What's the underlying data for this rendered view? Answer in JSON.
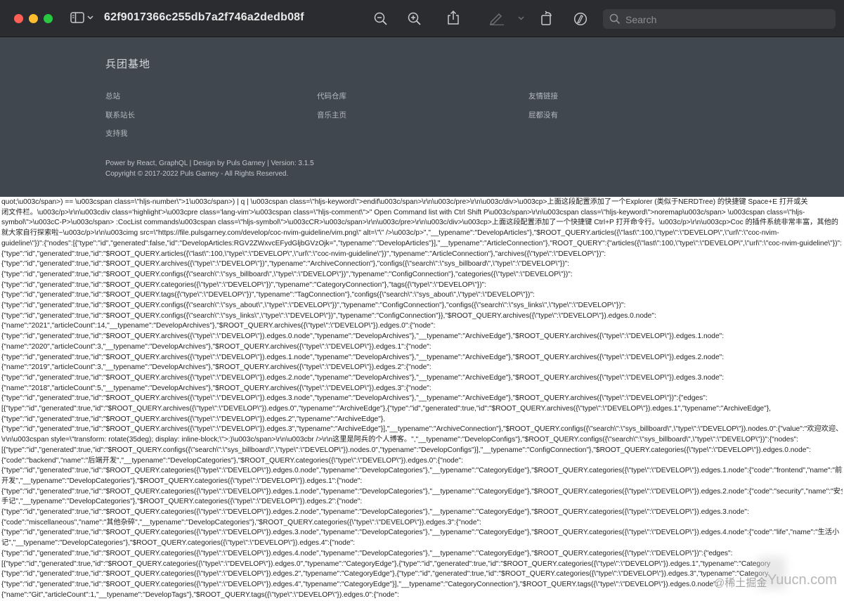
{
  "window": {
    "title": "62f9017366c255db7a2f746a2dedb08f",
    "search_placeholder": "Search",
    "toolbar_icons": [
      "sidebar-icon",
      "chevron-down-icon",
      "zoom-out-icon",
      "zoom-in-icon",
      "share-icon",
      "markup-pen-icon",
      "chevron-down-icon",
      "rotate-icon",
      "annotate-icon",
      "search-icon"
    ]
  },
  "footer": {
    "site_title": "兵团基地",
    "links": [
      "总站",
      "代码仓库",
      "友情链接",
      "联系站长",
      "音乐主页",
      "屁都没有",
      "支持我"
    ],
    "powered": "Power by React, GraphQL | Design by Puls Garney | Version: 3.1.5",
    "copyright": "Copyright © 2017-2022 Puls Garney - All Rights Reserved."
  },
  "dump_lines": [
    "quot;\\u003c/span>) == \\u003cspan class=\\\"hljs-number\\\">1\\u003c/span>) | q | \\u003cspan class=\\\"hljs-keyword\\\">endif\\u003c/span>\\r\\n\\u003c/pre>\\r\\n\\u003c/div>\\u003cp>上面这段配置添加了一个Explorer (类似于NERDTree) 的快捷键 Space+E 打开或关",
    "闭文件栏。\\u003c/p>\\r\\n\\u003cdiv class='highlight'>\\u003cpre class='lang-vim'>\\u003cspan class=\\\"hljs-comment\\\">\" Open Command list with Ctrl Shift P\\u003c/span>\\r\\n\\u003cspan class=\\\"hljs-keyword\\\">noremap\\u003c/span> \\u003cspan class=\\\"hljs-",
    "symbol\\\">\\u003cC-P>\\u003c/span> :CocList commands\\u003cspan class=\\\"hljs-symbol\\\">\\u003cCR>\\u003c/span>\\r\\n\\u003c/pre>\\r\\n\\u003c/div>\\u003cp>上面这段配置添加了一个快捷键 Ctrl+P 打开命令行。\\u003c/p>\\r\\n\\u003cp>Coc 的插件系统非常丰富，其他的",
    "就大家自行探索啦~\\u003c/p>\\r\\n\\u003cimg src=\\\"https://file.pulsgarney.com/develop/coc-nvim-guideline/vim.png\\\" alt=\\\"\\\" />\\u003c/p>\",\"__typename\":\"DevelopArticles\"},\"$ROOT_QUERY.articles({\\\"last\\\":100,\\\"type\\\":\\\"DEVELOP\\\",\\\"url\\\":\\\"coc-nvim-",
    "guideline\\\"})\":{\"nodes\":[{\"type\":\"id\",\"generated\":false,\"id\":\"DevelopArticles:RGV2ZWxvcEFydGljbGVzOjk=\",\"typename\":\"DevelopArticles\"}],\"__typename\":\"ArticleConnection\"},\"ROOT_QUERY\":{\"articles({\\\"last\\\":100,\\\"type\\\":\\\"DEVELOP\\\",\\\"url\\\":\\\"coc-nvim-guideline\\\"})\":",
    "{\"type\":\"id\",\"generated\":true,\"id\":\"$ROOT_QUERY.articles({\\\"last\\\":100,\\\"type\\\":\\\"DEVELOP\\\",\\\"url\\\":\\\"coc-nvim-guideline\\\"})\",\"typename\":\"ArticleConnection\"},\"archives({\\\"type\\\":\\\"DEVELOP\\\"})\":",
    "{\"type\":\"id\",\"generated\":true,\"id\":\"$ROOT_QUERY.archives({\\\"type\\\":\\\"DEVELOP\\\"})\",\"typename\":\"ArchiveConnection\"},\"configs({\\\"search\\\":\\\"sys_billboard\\\",\\\"type\\\":\\\"DEVELOP\\\"})\":",
    "{\"type\":\"id\",\"generated\":true,\"id\":\"$ROOT_QUERY.configs({\\\"search\\\":\\\"sys_billboard\\\",\\\"type\\\":\\\"DEVELOP\\\"})\",\"typename\":\"ConfigConnection\"},\"categories({\\\"type\\\":\\\"DEVELOP\\\"})\":",
    "{\"type\":\"id\",\"generated\":true,\"id\":\"$ROOT_QUERY.categories({\\\"type\\\":\\\"DEVELOP\\\"})\",\"typename\":\"CategoryConnection\"},\"tags({\\\"type\\\":\\\"DEVELOP\\\"})\":",
    "{\"type\":\"id\",\"generated\":true,\"id\":\"$ROOT_QUERY.tags({\\\"type\\\":\\\"DEVELOP\\\"})\",\"typename\":\"TagConnection\"},\"configs({\\\"search\\\":\\\"sys_about\\\",\\\"type\\\":\\\"DEVELOP\\\"})\":",
    "{\"type\":\"id\",\"generated\":true,\"id\":\"$ROOT_QUERY.configs({\\\"search\\\":\\\"sys_about\\\",\\\"type\\\":\\\"DEVELOP\\\"})\",\"typename\":\"ConfigConnection\"},\"configs({\\\"search\\\":\\\"sys_links\\\",\\\"type\\\":\\\"DEVELOP\\\"})\":",
    "{\"type\":\"id\",\"generated\":true,\"id\":\"$ROOT_QUERY.configs({\\\"search\\\":\\\"sys_links\\\",\\\"type\\\":\\\"DEVELOP\\\"})\",\"typename\":\"ConfigConnection\"}},\"$ROOT_QUERY.archives({\\\"type\\\":\\\"DEVELOP\\\"}).edges.0.node\":",
    "{\"name\":\"2021\",\"articleCount\":14,\"__typename\":\"DevelopArchives\"},\"$ROOT_QUERY.archives({\\\"type\\\":\\\"DEVELOP\\\"}).edges.0\":{\"node\":",
    "{\"type\":\"id\",\"generated\":true,\"id\":\"$ROOT_QUERY.archives({\\\"type\\\":\\\"DEVELOP\\\"}).edges.0.node\",\"typename\":\"DevelopArchives\"},\"__typename\":\"ArchiveEdge\"},\"$ROOT_QUERY.archives({\\\"type\\\":\\\"DEVELOP\\\"}).edges.1.node\":",
    "{\"name\":\"2020\",\"articleCount\":3,\"__typename\":\"DevelopArchives\"},\"$ROOT_QUERY.archives({\\\"type\\\":\\\"DEVELOP\\\"}).edges.1\":{\"node\":",
    "{\"type\":\"id\",\"generated\":true,\"id\":\"$ROOT_QUERY.archives({\\\"type\\\":\\\"DEVELOP\\\"}).edges.1.node\",\"typename\":\"DevelopArchives\"},\"__typename\":\"ArchiveEdge\"},\"$ROOT_QUERY.archives({\\\"type\\\":\\\"DEVELOP\\\"}).edges.2.node\":",
    "{\"name\":\"2019\",\"articleCount\":3,\"__typename\":\"DevelopArchives\"},\"$ROOT_QUERY.archives({\\\"type\\\":\\\"DEVELOP\\\"}).edges.2\":{\"node\":",
    "{\"type\":\"id\",\"generated\":true,\"id\":\"$ROOT_QUERY.archives({\\\"type\\\":\\\"DEVELOP\\\"}).edges.2.node\",\"typename\":\"DevelopArchives\"},\"__typename\":\"ArchiveEdge\"},\"$ROOT_QUERY.archives({\\\"type\\\":\\\"DEVELOP\\\"}).edges.3.node\":",
    "{\"name\":\"2018\",\"articleCount\":5,\"__typename\":\"DevelopArchives\"},\"$ROOT_QUERY.archives({\\\"type\\\":\\\"DEVELOP\\\"}).edges.3\":{\"node\":",
    "{\"type\":\"id\",\"generated\":true,\"id\":\"$ROOT_QUERY.archives({\\\"type\\\":\\\"DEVELOP\\\"}).edges.3.node\",\"typename\":\"DevelopArchives\"},\"__typename\":\"ArchiveEdge\"},\"$ROOT_QUERY.archives({\\\"type\\\":\\\"DEVELOP\\\"})\":{\"edges\":",
    "[{\"type\":\"id\",\"generated\":true,\"id\":\"$ROOT_QUERY.archives({\\\"type\\\":\\\"DEVELOP\\\"}).edges.0\",\"typename\":\"ArchiveEdge\"},{\"type\":\"id\",\"generated\":true,\"id\":\"$ROOT_QUERY.archives({\\\"type\\\":\\\"DEVELOP\\\"}).edges.1\",\"typename\":\"ArchiveEdge\"},",
    "{\"type\":\"id\",\"generated\":true,\"id\":\"$ROOT_QUERY.archives({\\\"type\\\":\\\"DEVELOP\\\"}).edges.2\",\"typename\":\"ArchiveEdge\"},",
    "{\"type\":\"id\",\"generated\":true,\"id\":\"$ROOT_QUERY.archives({\\\"type\\\":\\\"DEVELOP\\\"}).edges.3\",\"typename\":\"ArchiveEdge\"}],\"__typename\":\"ArchiveConnection\"},\"$ROOT_QUERY.configs({\\\"search\\\":\\\"sys_billboard\\\",\\\"type\\\":\\\"DEVELOP\\\"}).nodes.0\":{\"value\":\"欢迎欢迎、",
    "\\r\\n\\u003cspan style=\\\"transform: rotate(35deg); display: inline-block;\\\">:)\\u003c/span>\\r\\n\\u003cbr />\\r\\n这里是阿兵的个人博客。\",\"__typename\":\"DevelopConfigs\"},\"$ROOT_QUERY.configs({\\\"search\\\":\\\"sys_billboard\\\",\\\"type\\\":\\\"DEVELOP\\\"})\":{\"nodes\":",
    "[{\"type\":\"id\",\"generated\":true,\"id\":\"$ROOT_QUERY.configs({\\\"search\\\":\\\"sys_billboard\\\",\\\"type\\\":\\\"DEVELOP\\\"}).nodes.0\",\"typename\":\"DevelopConfigs\"}],\"__typename\":\"ConfigConnection\"},\"$ROOT_QUERY.categories({\\\"type\\\":\\\"DEVELOP\\\"}).edges.0.node\":",
    "{\"code\":\"backend\",\"name\":\"后端开发\",\"__typename\":\"DevelopCategories\"},\"$ROOT_QUERY.categories({\\\"type\\\":\\\"DEVELOP\\\"}).edges.0\":{\"node\":",
    "{\"type\":\"id\",\"generated\":true,\"id\":\"$ROOT_QUERY.categories({\\\"type\\\":\\\"DEVELOP\\\"}).edges.0.node\",\"typename\":\"DevelopCategories\"},\"__typename\":\"CategoryEdge\"},\"$ROOT_QUERY.categories({\\\"type\\\":\\\"DEVELOP\\\"}).edges.1.node\":{\"code\":\"frontend\",\"name\":\"前端",
    "开发\",\"__typename\":\"DevelopCategories\"},\"$ROOT_QUERY.categories({\\\"type\\\":\\\"DEVELOP\\\"}).edges.1\":{\"node\":",
    "{\"type\":\"id\",\"generated\":true,\"id\":\"$ROOT_QUERY.categories({\\\"type\\\":\\\"DEVELOP\\\"}).edges.1.node\",\"typename\":\"DevelopCategories\"},\"__typename\":\"CategoryEdge\"},\"$ROOT_QUERY.categories({\\\"type\\\":\\\"DEVELOP\\\"}).edges.2.node\":{\"code\":\"security\",\"name\":\"安全",
    "手记\",\"__typename\":\"DevelopCategories\"},\"$ROOT_QUERY.categories({\\\"type\\\":\\\"DEVELOP\\\"}).edges.2\":{\"node\":",
    "{\"type\":\"id\",\"generated\":true,\"id\":\"$ROOT_QUERY.categories({\\\"type\\\":\\\"DEVELOP\\\"}).edges.2.node\",\"typename\":\"DevelopCategories\"},\"__typename\":\"CategoryEdge\"},\"$ROOT_QUERY.categories({\\\"type\\\":\\\"DEVELOP\\\"}).edges.3.node\":",
    "{\"code\":\"miscellaneous\",\"name\":\"其他杂碎\",\"__typename\":\"DevelopCategories\"},\"$ROOT_QUERY.categories({\\\"type\\\":\\\"DEVELOP\\\"}).edges.3\":{\"node\":",
    "{\"type\":\"id\",\"generated\":true,\"id\":\"$ROOT_QUERY.categories({\\\"type\\\":\\\"DEVELOP\\\"}).edges.3.node\",\"typename\":\"DevelopCategories\"},\"__typename\":\"CategoryEdge\"},\"$ROOT_QUERY.categories({\\\"type\\\":\\\"DEVELOP\\\"}).edges.4.node\":{\"code\":\"life\",\"name\":\"生活小",
    "记\",\"__typename\":\"DevelopCategories\"},\"$ROOT_QUERY.categories({\\\"type\\\":\\\"DEVELOP\\\"}).edges.4\":{\"node\":",
    "{\"type\":\"id\",\"generated\":true,\"id\":\"$ROOT_QUERY.categories({\\\"type\\\":\\\"DEVELOP\\\"}).edges.4.node\",\"typename\":\"DevelopCategories\"},\"__typename\":\"CategoryEdge\"},\"$ROOT_QUERY.categories({\\\"type\\\":\\\"DEVELOP\\\"})\":{\"edges\":",
    "[{\"type\":\"id\",\"generated\":true,\"id\":\"$ROOT_QUERY.categories({\\\"type\\\":\\\"DEVELOP\\\"}).edges.0\",\"typename\":\"CategoryEdge\"},{\"type\":\"id\",\"generated\":true,\"id\":\"$ROOT_QUERY.categories({\\\"type\\\":\\\"DEVELOP\\\"}).edges.1\",\"typename\":\"Category",
    "{\"type\":\"id\",\"generated\":true,\"id\":\"$ROOT_QUERY.categories({\\\"type\\\":\\\"DEVELOP\\\"}).edges.2\",\"typename\":\"CategoryEdge\"},{\"type\":\"id\",\"generated\":true,\"id\":\"$ROOT_QUERY.categories({\\\"type\\\":\\\"DEVELOP\\\"}).edges.3\",\"typename\":\"Category",
    "{\"type\":\"id\",\"generated\":true,\"id\":\"$ROOT_QUERY.categories({\\\"type\\\":\\\"DEVELOP\\\"}).edges.4\",\"typename\":\"CategoryEdge\"}],\"__typename\":\"CategoryConnection\"},\"$ROOT_QUERY.tags({\\\"type\\\":\\\"DEVELOP\\\"}).edges.0.node\":",
    "{\"name\":\"Git\",\"articleCount\":1,\"__typename\":\"DevelopTags\"},\"$ROOT_QUERY.tags({\\\"type\\\":\\\"DEVELOP\\\"}).edges.0\":{\"node\":"
  ],
  "watermark": {
    "left": "@稀土掘金",
    "right": "Yuucn.com"
  }
}
